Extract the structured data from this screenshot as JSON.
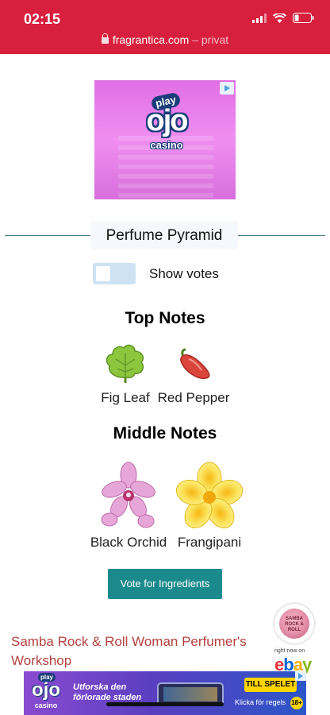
{
  "status_bar": {
    "time": "02:15"
  },
  "browser": {
    "domain": "fragrantica.com",
    "suffix": "– privat"
  },
  "ad_top": {
    "brand_play": "play",
    "brand_ojo": "ojo",
    "brand_casino": "casino"
  },
  "pyramid": {
    "title": "Perfume Pyramid",
    "toggle_label": "Show votes",
    "top_notes_title": "Top Notes",
    "top_notes": [
      {
        "label": "Fig Leaf",
        "icon": "fig-leaf-icon"
      },
      {
        "label": "Red Pepper",
        "icon": "red-pepper-icon"
      }
    ],
    "middle_notes_title": "Middle Notes",
    "middle_notes": [
      {
        "label": "Black Orchid",
        "icon": "orchid-icon"
      },
      {
        "label": "Frangipani",
        "icon": "frangipani-icon"
      }
    ],
    "vote_button": "Vote for Ingredients"
  },
  "related": {
    "link_text": "Samba Rock & Roll Woman Perfumer's Workshop",
    "ebay_thumb_text": "SAMBA ROCK & ROLL",
    "ebay_caption": "right now on"
  },
  "ad_bottom": {
    "brand_play": "play",
    "brand_ojo": "ojo",
    "brand_casino": "casino",
    "tagline": "Utforska den förlorade staden",
    "cta": "TILL SPELET",
    "fine_print": "Klicka för regels",
    "age": "18+"
  },
  "colors": {
    "status_bar": "#d81f3d",
    "link": "#b3403f",
    "button": "#1b8a8d",
    "toggle": "#cde3f3"
  }
}
